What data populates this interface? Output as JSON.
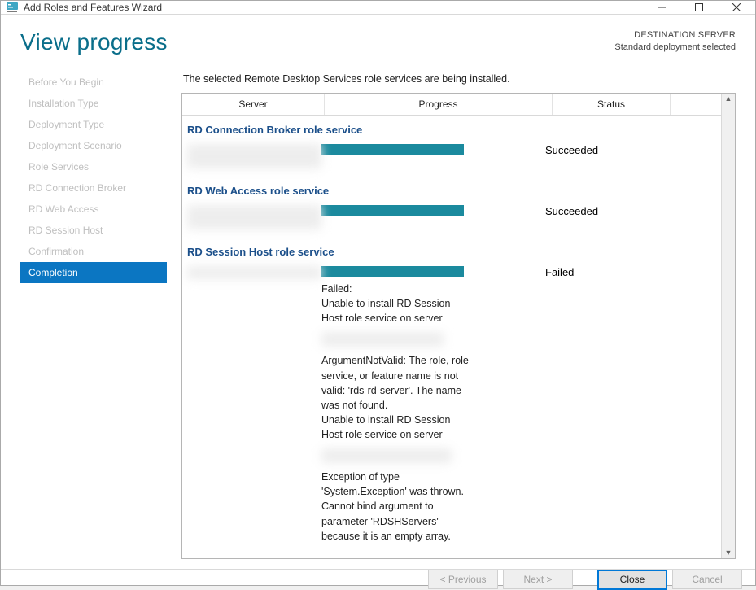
{
  "window": {
    "title": "Add Roles and Features Wizard"
  },
  "page": {
    "heading": "View progress",
    "destination_label": "DESTINATION SERVER",
    "destination_value": "Standard deployment selected",
    "description": "The selected Remote Desktop Services role services are being installed."
  },
  "steps": [
    "Before You Begin",
    "Installation Type",
    "Deployment Type",
    "Deployment Scenario",
    "Role Services",
    "RD Connection Broker",
    "RD Web Access",
    "RD Session Host",
    "Confirmation",
    "Completion"
  ],
  "active_step_index": 9,
  "columns": {
    "server": "Server",
    "progress": "Progress",
    "status": "Status"
  },
  "sections": [
    {
      "title": "RD Connection Broker role service",
      "status": "Succeeded",
      "error_lines": []
    },
    {
      "title": "RD Web Access role service",
      "status": "Succeeded",
      "error_lines": []
    },
    {
      "title": "RD Session Host role service",
      "status": "Failed",
      "error_lines": [
        "Failed:",
        "Unable to install RD Session Host role service on server",
        "",
        "ArgumentNotValid: The role, role service, or feature name is not valid: 'rds-rd-server'. The name was not found.",
        "Unable to install RD Session Host role service on server",
        "",
        "Exception of type 'System.Exception' was thrown.",
        "Cannot bind argument to parameter 'RDSHServers' because it is an empty array."
      ]
    }
  ],
  "buttons": {
    "previous": "< Previous",
    "next": "Next >",
    "close": "Close",
    "cancel": "Cancel"
  },
  "colors": {
    "accent_teal": "#1b8a9e",
    "heading_blue": "#0a6e8a",
    "section_blue": "#1b4f8a",
    "active_step_bg": "#0b76c2"
  }
}
